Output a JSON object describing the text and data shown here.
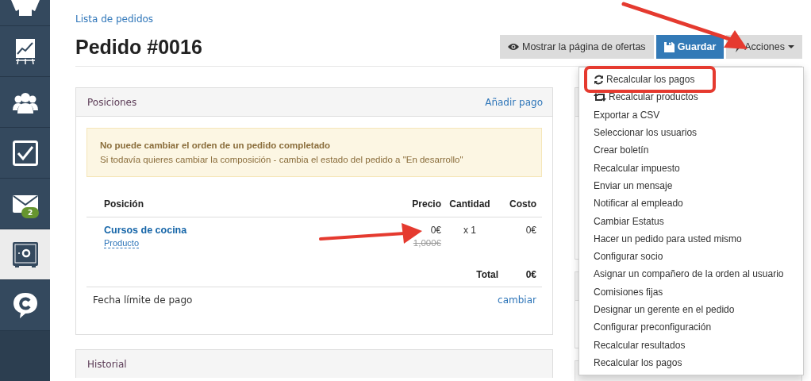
{
  "sidebar": {
    "items": [
      {
        "selected": false
      },
      {
        "selected": false
      },
      {
        "selected": false
      },
      {
        "selected": false
      },
      {
        "selected": false,
        "badge": "2"
      },
      {
        "selected": true
      },
      {
        "selected": false
      }
    ]
  },
  "breadcrumb": "Lista de pedidos",
  "title": "Pedido #0016",
  "buttons": [
    {
      "kind": "view",
      "label": "Mostrar la página de ofertas"
    },
    {
      "kind": "save",
      "label": "Guardar"
    },
    {
      "kind": "actions",
      "label": "Acciones"
    }
  ],
  "positions_panel": {
    "title": "Posiciones",
    "action": "Añadir pago",
    "alert": {
      "title": "No puede cambiar el orden de un pedido completado",
      "text": "Si todavía quieres cambiar la composición - cambia el estado del pedido a \"En desarrollo\""
    },
    "table": {
      "columns": [
        "Posición",
        "Precio",
        "Cantidad",
        "Costo"
      ],
      "rows": [
        {
          "name": "Cursos de cocina",
          "type": "Producto",
          "price": "0€",
          "old_price": "1,000€",
          "quantity": "x 1",
          "cost": "0€"
        }
      ],
      "total_label": "Total",
      "total": "0€"
    },
    "deadline_label": "Fecha límite de pago",
    "deadline_action": "cambiar"
  },
  "history_panel": {
    "title": "Historial"
  },
  "actions_menu": {
    "items": [
      {
        "label": "Recalcular los pagos"
      },
      {
        "label": "Recalcular productos"
      },
      {
        "label": "Exportar a CSV"
      },
      {
        "label": "Seleccionar los usuarios"
      },
      {
        "label": "Crear boletín"
      },
      {
        "label": "Recalcular impuesto"
      },
      {
        "label": "Enviar un mensaje"
      },
      {
        "label": "Notificar al empleado"
      },
      {
        "label": "Cambiar Estatus"
      },
      {
        "label": "Hacer un pedido para usted mismo"
      },
      {
        "label": "Configurar socio"
      },
      {
        "label": "Asignar un compañero de la orden al usuario"
      },
      {
        "label": "Comisiones fijas"
      },
      {
        "label": "Designar un gerente en el pedido"
      },
      {
        "label": "Configurar preconfiguración"
      },
      {
        "label": "Recalcular resultados"
      },
      {
        "label": "Recalcular los pagos"
      }
    ]
  }
}
